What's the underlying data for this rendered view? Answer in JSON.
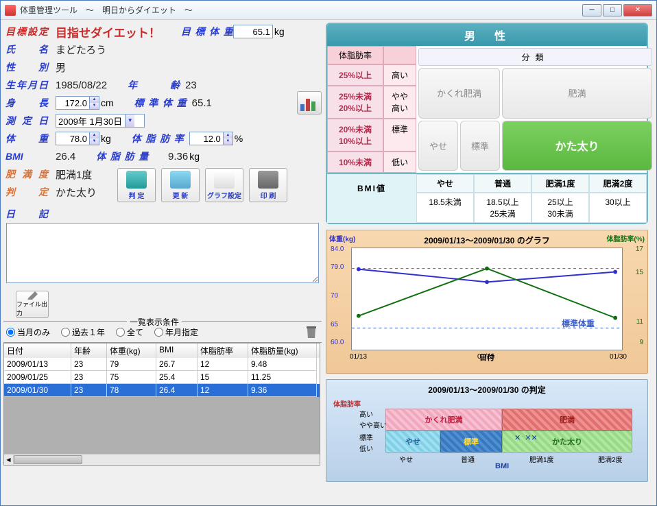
{
  "window": {
    "title": "体重管理ツール　〜　明日からダイエット　〜"
  },
  "form": {
    "goal_lbl": "目標設定",
    "goal_slogan": "目指せダイエット！",
    "target_weight_lbl": "目標体重",
    "target_weight": "65.1",
    "target_weight_unit": "kg",
    "name_lbl": "氏名",
    "name": "まどたろう",
    "sex_lbl": "性別",
    "sex": "男",
    "birth_lbl": "生年月日",
    "birth": "1985/08/22",
    "age_lbl": "年齢",
    "age": "23",
    "height_lbl": "身長",
    "height": "172.0",
    "height_unit": "cm",
    "std_weight_lbl": "標準体重",
    "std_weight": "65.1",
    "measure_date_lbl": "測定日",
    "measure_date": "2009年  1月30日",
    "weight_lbl": "体重",
    "weight": "78.0",
    "weight_unit": "kg",
    "bodyfat_lbl": "体脂肪率",
    "bodyfat": "12.0",
    "bodyfat_unit": "%",
    "bmi_lbl": "BMI",
    "bmi": "26.4",
    "fatmass_lbl": "体脂肪量",
    "fatmass": "9.36",
    "fatmass_unit": "kg",
    "obesity_lbl": "肥満度",
    "obesity": "肥満1度",
    "judge_lbl": "判定",
    "judge": "かた太り",
    "diary_lbl": "日記"
  },
  "toolbar": {
    "judge": "判 定",
    "update": "更 新",
    "graph": "グラフ設定",
    "print": "印 刷"
  },
  "fileout": "ファイル出力",
  "filter": {
    "title": "一覧表示条件",
    "r1": "当月のみ",
    "r2": "過去１年",
    "r3": "全て",
    "r4": "年月指定"
  },
  "table": {
    "headers": [
      "日付",
      "年齢",
      "体重(kg)",
      "BMI",
      "体脂肪率",
      "体脂肪量(kg)"
    ],
    "rows": [
      {
        "date": "2009/01/13",
        "age": "23",
        "w": "79",
        "bmi": "26.7",
        "bf": "12",
        "bfm": "9.48"
      },
      {
        "date": "2009/01/25",
        "age": "23",
        "w": "75",
        "bmi": "25.4",
        "bf": "15",
        "bfm": "11.25"
      },
      {
        "date": "2009/01/30",
        "age": "23",
        "w": "78",
        "bmi": "26.4",
        "bf": "12",
        "bfm": "9.36"
      }
    ]
  },
  "male_panel": {
    "title": "男　性",
    "bfrate_lbl": "体脂肪率",
    "class_lbl": "分類",
    "rows": [
      {
        "range": "25%以上",
        "label": "高い"
      },
      {
        "range": "25%未満\n20%以上",
        "label": "やや\n高い"
      },
      {
        "range": "20%未満\n10%以上",
        "label": "標準"
      },
      {
        "range": "10%未満",
        "label": "低い"
      }
    ],
    "cats": {
      "hidden": "かくれ肥満",
      "obese": "肥満",
      "thin": "やせ",
      "std": "標準",
      "toned": "かた太り"
    },
    "bmi_lbl": "BMI値",
    "bmi_cats": [
      "やせ",
      "普通",
      "肥満1度",
      "肥満2度"
    ],
    "bmi_vals": [
      "18.5未満",
      "18.5以上\n25未満",
      "25以上\n30未満",
      "30以上"
    ]
  },
  "chart": {
    "title": "2009/01/13〜2009/01/30 のグラフ",
    "y1_label": "体重(kg)",
    "y2_label": "体脂肪率(%)",
    "x_label": "日付",
    "std_label": "標準体重"
  },
  "judge_panel": {
    "title": "2009/01/13〜2009/01/30 の判定",
    "y_label": "体脂肪率",
    "x_label": "BMI",
    "y_ticks": [
      "高い",
      "やや高い",
      "標準",
      "低い"
    ],
    "x_ticks": [
      "やせ",
      "普通",
      "肥満1度",
      "肥満2度"
    ],
    "boxes": {
      "hidden": "かくれ肥満",
      "obese": "肥満",
      "thin": "やせ",
      "std": "標準",
      "toned": "かた太り"
    }
  },
  "chart_data": {
    "type": "line",
    "title": "2009/01/13〜2009/01/30 のグラフ",
    "x": [
      "01/13",
      "01/25",
      "01/30"
    ],
    "series": [
      {
        "name": "体重(kg)",
        "values": [
          79,
          76,
          78.5
        ],
        "axis": "left",
        "ylim": [
          60,
          84
        ]
      },
      {
        "name": "体脂肪率(%)",
        "values": [
          11.5,
          15,
          11.5
        ],
        "axis": "right",
        "ylim": [
          9,
          17
        ]
      }
    ],
    "reference_lines": [
      {
        "name": "目標体重",
        "value": 79,
        "axis": "left",
        "style": "dashed-red"
      },
      {
        "name": "標準体重",
        "value": 65.1,
        "axis": "left",
        "style": "dashed-blue"
      }
    ],
    "y_ticks_left": [
      60,
      65,
      70,
      79,
      84
    ],
    "y_ticks_right": [
      9,
      11,
      15,
      17
    ],
    "xlabel": "日付"
  }
}
